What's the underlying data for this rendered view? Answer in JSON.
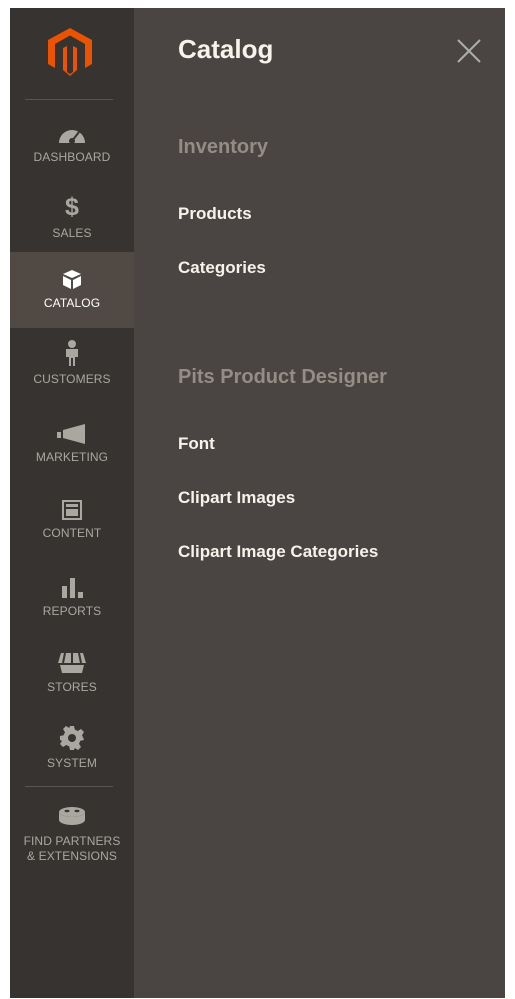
{
  "sidebar": {
    "items": [
      {
        "label": "DASHBOARD",
        "icon": "dashboard-icon"
      },
      {
        "label": "SALES",
        "icon": "dollar-icon"
      },
      {
        "label": "CATALOG",
        "icon": "box-icon",
        "active": true
      },
      {
        "label": "CUSTOMERS",
        "icon": "person-icon"
      },
      {
        "label": "MARKETING",
        "icon": "megaphone-icon"
      },
      {
        "label": "CONTENT",
        "icon": "layout-icon"
      },
      {
        "label": "REPORTS",
        "icon": "bar-chart-icon"
      },
      {
        "label": "STORES",
        "icon": "storefront-icon"
      },
      {
        "label": "SYSTEM",
        "icon": "gear-icon"
      },
      {
        "label": "FIND PARTNERS\n& EXTENSIONS",
        "icon": "blocks-icon"
      }
    ]
  },
  "panel": {
    "title": "Catalog",
    "sections": [
      {
        "title": "Inventory",
        "links": [
          "Products",
          "Categories"
        ]
      },
      {
        "title": "Pits Product Designer",
        "links": [
          "Font",
          "Clipart Images",
          "Clipart Image Categories"
        ]
      }
    ]
  },
  "colors": {
    "sidebar_bg": "#373330",
    "panel_bg": "#4a4542",
    "active_bg": "#514943",
    "logo_orange": "#eb5202"
  }
}
